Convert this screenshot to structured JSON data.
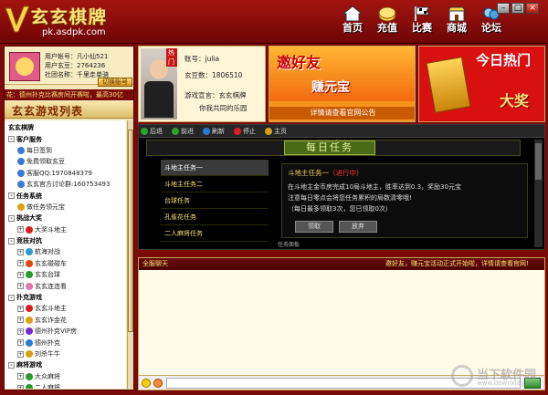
{
  "app": {
    "title": "玄玄棋牌",
    "url": "pk.asdpk.com"
  },
  "nav": [
    {
      "label": "首页",
      "icon": "house-icon"
    },
    {
      "label": "充值",
      "icon": "coin-icon"
    },
    {
      "label": "比赛",
      "icon": "flag-icon"
    },
    {
      "label": "商城",
      "icon": "shop-icon"
    },
    {
      "label": "论坛",
      "icon": "forum-icon"
    }
  ],
  "user": {
    "account": "用户帐号：凡小仙521",
    "beans": "用户玄豆：2764236",
    "group": "社团名称：千里走单骑",
    "switch_label": "切换账号"
  },
  "marquee": "花：德州扑克比赛房间开赛啦，最高30亿",
  "games": {
    "title": "玄玄游戏列表",
    "tree": [
      {
        "label": "玄玄棋牌",
        "level": 0,
        "type": "root"
      },
      {
        "label": "客户服务",
        "level": 1,
        "type": "cat",
        "exp": "-"
      },
      {
        "label": "每日签到",
        "level": 2,
        "type": "item",
        "color": "#3a7ad2"
      },
      {
        "label": "免费领取玄豆",
        "level": 2,
        "type": "item",
        "color": "#3a7ad2"
      },
      {
        "label": "客服QQ:1970848379",
        "level": 2,
        "type": "item",
        "color": "#3a7ad2"
      },
      {
        "label": "玄玄官方讨论群:160753493",
        "level": 2,
        "type": "item",
        "color": "#3a7ad2"
      },
      {
        "label": "任务系统",
        "level": 1,
        "type": "cat",
        "exp": "-"
      },
      {
        "label": "做任务领元宝",
        "level": 2,
        "type": "item",
        "color": "#e0a010"
      },
      {
        "label": "挑战大奖",
        "level": 1,
        "type": "cat",
        "exp": "-"
      },
      {
        "label": "大奖斗地主",
        "level": 2,
        "type": "item",
        "color": "#d82020",
        "exp": "+"
      },
      {
        "label": "竞技对抗",
        "level": 1,
        "type": "cat",
        "exp": "-"
      },
      {
        "label": "航海对战",
        "level": 2,
        "type": "item",
        "color": "#2a9ad2",
        "exp": "+"
      },
      {
        "label": "玄玄碰碰车",
        "level": 2,
        "type": "item",
        "color": "#d84a10",
        "exp": "+"
      },
      {
        "label": "玄玄台球",
        "level": 2,
        "type": "item",
        "color": "#2a9a2a",
        "exp": "+"
      },
      {
        "label": "玄玄连连看",
        "level": 2,
        "type": "item",
        "color": "#e07ab0",
        "exp": "+"
      },
      {
        "label": "扑克游戏",
        "level": 1,
        "type": "cat",
        "exp": "-"
      },
      {
        "label": "玄玄斗地主",
        "level": 2,
        "type": "item",
        "color": "#d82020",
        "exp": "+"
      },
      {
        "label": "玄玄诈金花",
        "level": 2,
        "type": "item",
        "color": "#e0a010",
        "exp": "+"
      },
      {
        "label": "德州扑克VIP房",
        "level": 2,
        "type": "item",
        "color": "#7a2ad2",
        "exp": "+"
      },
      {
        "label": "德州扑克",
        "level": 2,
        "type": "item",
        "color": "#2a7ad2",
        "exp": "+"
      },
      {
        "label": "刘杀牛牛",
        "level": 2,
        "type": "item",
        "color": "#d8a010",
        "exp": "+"
      },
      {
        "label": "麻将游戏",
        "level": 1,
        "type": "cat",
        "exp": "-"
      },
      {
        "label": "大众麻将",
        "level": 2,
        "type": "item",
        "color": "#2a9a2a",
        "exp": "+"
      },
      {
        "label": "二人麻将",
        "level": 2,
        "type": "item",
        "color": "#2a9a2a",
        "exp": "+"
      }
    ]
  },
  "profile": {
    "badge": "热门",
    "account": "账号：julia",
    "beans": "玄豆数：1806510",
    "slogan_label": "游戏宣言：玄玄棋牌",
    "slogan": "你我共同的乐园"
  },
  "banner_invite": {
    "title": "邀好友",
    "subtitle": "赚元宝",
    "footer": "详情请查看官网公告"
  },
  "banner_hot": {
    "title": "今日热门",
    "subtitle": "大奖"
  },
  "toolbar": {
    "back": "后退",
    "forward": "前进",
    "refresh": "刷新",
    "stop": "停止",
    "home": "主页"
  },
  "daily": {
    "title": "每日任务",
    "tasks": [
      "斗地主任务一",
      "斗地主任务二",
      "台球任务",
      "孔雀花任务",
      "二人麻将任务"
    ],
    "more": "任务面板",
    "detail": {
      "title": "斗地主任务一",
      "status": "（进行中）",
      "line1": "在斗地主金币房完成10局斗地主，胜率达到0.3，奖励30元宝",
      "line2": "注意每日零点会将您任务累积的局数清零哦!",
      "line3": "（每日最多领取3次，您已领取0次）",
      "btn_claim": "领取",
      "btn_abandon": "放弃"
    }
  },
  "chat": {
    "title": "全服聊天",
    "notice": "邀好友，赚元宝活动正式开始啦，详情请查看官网!"
  },
  "watermark": {
    "text": "当下软件园",
    "url": "www.downxia.com"
  }
}
